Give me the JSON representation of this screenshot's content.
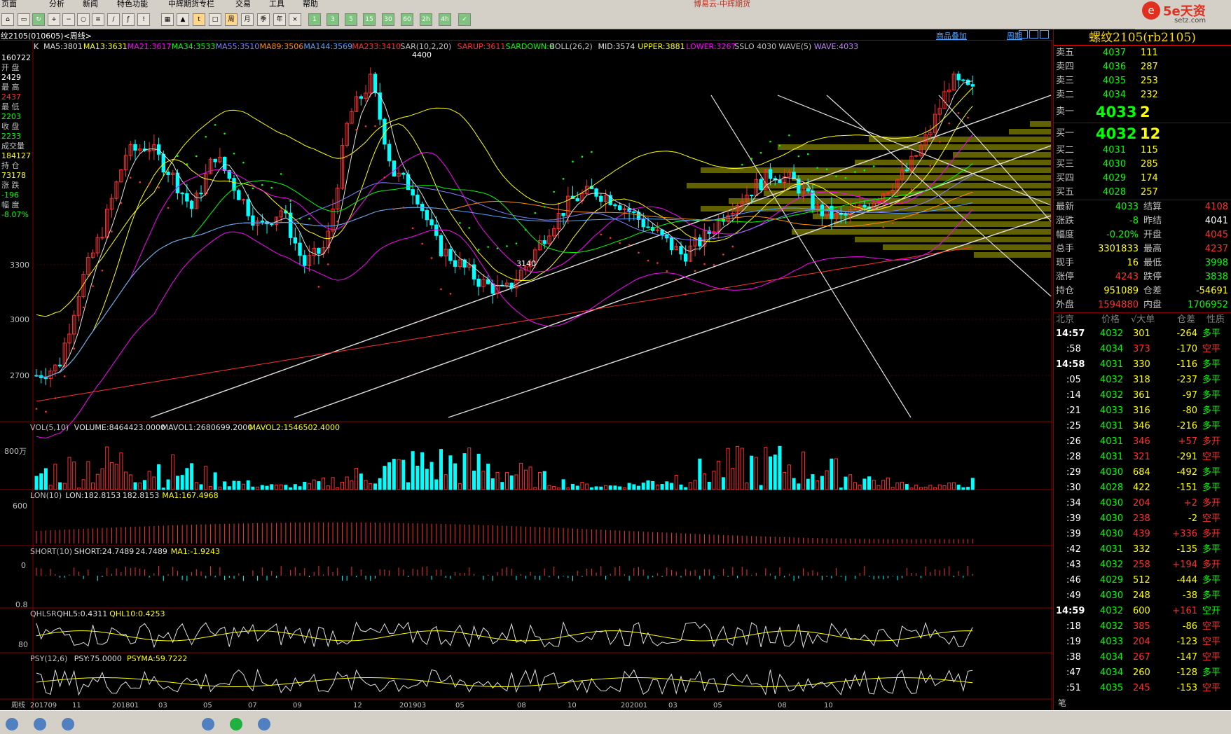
{
  "menu": [
    "页面",
    "分析",
    "新闻",
    "特色功能",
    "中辉期货专栏",
    "交易",
    "工具",
    "帮助"
  ],
  "window_title": "博易云-中辉期货",
  "logo_text": "5e天资",
  "logo_sub": "setz.com",
  "symbol_label": "纹2105(010605)<周线>",
  "header_links": [
    "商品叠加",
    "周期"
  ],
  "left_info": {
    "top_value": "160722",
    "rows": [
      {
        "label": "开 盘",
        "value": "2429",
        "color": "#ffffff"
      },
      {
        "label": "最 高",
        "value": "2437",
        "color": "#ff3030"
      },
      {
        "label": "最 低",
        "value": "2203",
        "color": "#00ff00"
      },
      {
        "label": "收 盘",
        "value": "2233",
        "color": "#00ff00"
      },
      {
        "label": "成交量",
        "value": "184127",
        "color": "#ffff00"
      },
      {
        "label": "持 仓",
        "value": "73178",
        "color": "#ffff00"
      },
      {
        "label": "涨 跌",
        "value": "-196",
        "color": "#00ff00"
      },
      {
        "label": "幅 度",
        "value": "-8.07%",
        "color": "#00ff00"
      }
    ]
  },
  "ma_legend": [
    {
      "text": "K",
      "color": "#e0e0e0"
    },
    {
      "text": "MA5:3801",
      "color": "#e0e0e0"
    },
    {
      "text": "MA13:3631",
      "color": "#ffff00"
    },
    {
      "text": "MA21:3617",
      "color": "#ff00ff"
    },
    {
      "text": "MA34:3533",
      "color": "#00ff00"
    },
    {
      "text": "MA55:3510",
      "color": "#8080ff"
    },
    {
      "text": "MA89:3506",
      "color": "#ff8c00"
    },
    {
      "text": "MA144:3569",
      "color": "#4fa3ff"
    },
    {
      "text": "MA233:3410",
      "color": "#ff3030"
    },
    {
      "text": "SAR(10,2,20)",
      "color": "#c0c0c0"
    },
    {
      "text": "SARUP:3611",
      "color": "#ff3030"
    },
    {
      "text": "SARDOWN:0",
      "color": "#00ff00"
    },
    {
      "text": "BOLL(26,2)",
      "color": "#c0c0c0"
    },
    {
      "text": "MID:3574",
      "color": "#e0e0e0"
    },
    {
      "text": "UPPER:3881",
      "color": "#ffff00"
    },
    {
      "text": "LOWER:3267",
      "color": "#ff00ff"
    },
    {
      "text": "SSLO 4030",
      "color": "#c0c0c0"
    },
    {
      "text": "WAVE(5)",
      "color": "#c0c0c0"
    },
    {
      "text": "WAVE:4033",
      "color": "#c080ff"
    }
  ],
  "price_axis": [
    "3300",
    "3000",
    "2700"
  ],
  "annotations": {
    "high": "4400",
    "low": "3140"
  },
  "vol_legend": [
    {
      "text": "VOL(5,10)",
      "color": "#c0c0c0"
    },
    {
      "text": "VOLUME:8464423.0000",
      "color": "#e0e0e0"
    },
    {
      "text": "MAVOL1:2680699.2000",
      "color": "#e0e0e0"
    },
    {
      "text": "MAVOL2:1546502.4000",
      "color": "#ffff00"
    }
  ],
  "vol_axis": "800万",
  "lon_legend": [
    {
      "text": "LON(10)",
      "color": "#c0c0c0"
    },
    {
      "text": "LON:182.8153",
      "color": "#e0e0e0"
    },
    {
      "text": "182.8153",
      "color": "#e0e0e0"
    },
    {
      "text": "MA1:167.4968",
      "color": "#ffff00"
    }
  ],
  "lon_axis": "600",
  "short_legend": [
    {
      "text": "SHORT(10)",
      "color": "#c0c0c0"
    },
    {
      "text": "SHORT:24.7489",
      "color": "#e0e0e0"
    },
    {
      "text": "24.7489",
      "color": "#e0e0e0"
    },
    {
      "text": "MA1:-1.9243",
      "color": "#ffff00"
    }
  ],
  "short_axis": "0",
  "qhl_legend": [
    {
      "text": "QHLSR",
      "color": "#c0c0c0"
    },
    {
      "text": "QHL5:0.4311",
      "color": "#e0e0e0"
    },
    {
      "text": "QHL10:0.4253",
      "color": "#ffff00"
    }
  ],
  "qhl_axis": "0.8",
  "psy_legend": [
    {
      "text": "PSY(12,6)",
      "color": "#c0c0c0"
    },
    {
      "text": "PSY:75.0000",
      "color": "#e0e0e0"
    },
    {
      "text": "PSYMA:59.7222",
      "color": "#ffff00"
    }
  ],
  "psy_axis": "80",
  "x_axis": [
    "周线",
    "201709",
    "11",
    "201801",
    "03",
    "05",
    "07",
    "09",
    "12",
    "201903",
    "05",
    "08",
    "10",
    "202001",
    "03",
    "05",
    "08",
    "10"
  ],
  "sidebar": {
    "title": "螺纹2105(rb2105)",
    "asks": [
      {
        "label": "卖五",
        "price": "4037",
        "vol": "111"
      },
      {
        "label": "卖四",
        "price": "4036",
        "vol": "287"
      },
      {
        "label": "卖三",
        "price": "4035",
        "vol": "253"
      },
      {
        "label": "卖二",
        "price": "4034",
        "vol": "232"
      }
    ],
    "ask1": {
      "label": "卖一",
      "price": "4033",
      "vol": "2"
    },
    "bid1": {
      "label": "买一",
      "price": "4032",
      "vol": "12"
    },
    "bids": [
      {
        "label": "买二",
        "price": "4031",
        "vol": "115"
      },
      {
        "label": "买三",
        "price": "4030",
        "vol": "285"
      },
      {
        "label": "买四",
        "price": "4029",
        "vol": "174"
      },
      {
        "label": "买五",
        "price": "4028",
        "vol": "257"
      }
    ],
    "stats": [
      {
        "l1": "最新",
        "v1": "4033",
        "c1": "#00ff00",
        "l2": "结算",
        "v2": "4108",
        "c2": "#ff3030"
      },
      {
        "l1": "涨跌",
        "v1": "-8",
        "c1": "#00ff00",
        "l2": "昨结",
        "v2": "4041",
        "c2": "#ffffff"
      },
      {
        "l1": "幅度",
        "v1": "-0.20%",
        "c1": "#00ff00",
        "l2": "开盘",
        "v2": "4045",
        "c2": "#ff3030"
      },
      {
        "l1": "总手",
        "v1": "3301833",
        "c1": "#ffff00",
        "l2": "最高",
        "v2": "4237",
        "c2": "#ff3030"
      },
      {
        "l1": "现手",
        "v1": "16",
        "c1": "#ffff00",
        "l2": "最低",
        "v2": "3998",
        "c2": "#00ff00"
      },
      {
        "l1": "涨停",
        "v1": "4243",
        "c1": "#ff3030",
        "l2": "跌停",
        "v2": "3838",
        "c2": "#00ff00"
      },
      {
        "l1": "持仓",
        "v1": "951089",
        "c1": "#ffff00",
        "l2": "仓差",
        "v2": "-54691",
        "c2": "#ffff00"
      },
      {
        "l1": "外盘",
        "v1": "1594880",
        "c1": "#ff3030",
        "l2": "内盘",
        "v2": "1706952",
        "c2": "#00ff00"
      }
    ],
    "tick_headers": [
      "北京",
      "价格",
      "√大单",
      "仓差",
      "性质"
    ],
    "ticks": [
      {
        "t": "14:57",
        "p": "4032",
        "v": "301",
        "d": "-264",
        "n": "多平",
        "nc": "#00ff00",
        "vc": "#ffff00",
        "dc": "#ffff00"
      },
      {
        "t": ":58",
        "p": "4034",
        "v": "373",
        "d": "-170",
        "n": "空平",
        "nc": "#ff3030",
        "vc": "#ff3030",
        "dc": "#ffff00"
      },
      {
        "t": "14:58",
        "p": "4031",
        "v": "330",
        "d": "-116",
        "n": "多平",
        "nc": "#00ff00",
        "vc": "#ffff00",
        "dc": "#ffff00"
      },
      {
        "t": ":05",
        "p": "4032",
        "v": "318",
        "d": "-237",
        "n": "多平",
        "nc": "#00ff00",
        "vc": "#ffff00",
        "dc": "#ffff00"
      },
      {
        "t": ":14",
        "p": "4032",
        "v": "361",
        "d": "-97",
        "n": "多平",
        "nc": "#00ff00",
        "vc": "#ffff00",
        "dc": "#ffff00"
      },
      {
        "t": ":21",
        "p": "4033",
        "v": "316",
        "d": "-80",
        "n": "多平",
        "nc": "#00ff00",
        "vc": "#ffff00",
        "dc": "#ffff00"
      },
      {
        "t": ":25",
        "p": "4031",
        "v": "346",
        "d": "-216",
        "n": "多平",
        "nc": "#00ff00",
        "vc": "#ffff00",
        "dc": "#ffff00"
      },
      {
        "t": ":26",
        "p": "4031",
        "v": "346",
        "d": "+57",
        "n": "多开",
        "nc": "#ff3030",
        "vc": "#ff3030",
        "dc": "#ff3030"
      },
      {
        "t": ":28",
        "p": "4031",
        "v": "321",
        "d": "-291",
        "n": "空平",
        "nc": "#ff3030",
        "vc": "#ff3030",
        "dc": "#ffff00"
      },
      {
        "t": ":29",
        "p": "4030",
        "v": "684",
        "d": "-492",
        "n": "多平",
        "nc": "#00ff00",
        "vc": "#ffff00",
        "dc": "#ffff00"
      },
      {
        "t": ":30",
        "p": "4028",
        "v": "422",
        "d": "-151",
        "n": "多平",
        "nc": "#00ff00",
        "vc": "#ffff00",
        "dc": "#ffff00"
      },
      {
        "t": ":34",
        "p": "4030",
        "v": "204",
        "d": "+2",
        "n": "多开",
        "nc": "#ff3030",
        "vc": "#ff3030",
        "dc": "#ff3030"
      },
      {
        "t": ":39",
        "p": "4030",
        "v": "238",
        "d": "-2",
        "n": "空平",
        "nc": "#ff3030",
        "vc": "#ff3030",
        "dc": "#ffff00"
      },
      {
        "t": ":39",
        "p": "4030",
        "v": "439",
        "d": "+336",
        "n": "多开",
        "nc": "#ff3030",
        "vc": "#ff3030",
        "dc": "#ff3030"
      },
      {
        "t": ":42",
        "p": "4031",
        "v": "332",
        "d": "-135",
        "n": "多平",
        "nc": "#00ff00",
        "vc": "#ffff00",
        "dc": "#ffff00"
      },
      {
        "t": ":43",
        "p": "4032",
        "v": "258",
        "d": "+194",
        "n": "多开",
        "nc": "#ff3030",
        "vc": "#ff3030",
        "dc": "#ff3030"
      },
      {
        "t": ":46",
        "p": "4029",
        "v": "512",
        "d": "-444",
        "n": "多平",
        "nc": "#00ff00",
        "vc": "#ffff00",
        "dc": "#ffff00"
      },
      {
        "t": ":49",
        "p": "4030",
        "v": "248",
        "d": "-38",
        "n": "多平",
        "nc": "#00ff00",
        "vc": "#ffff00",
        "dc": "#ffff00"
      },
      {
        "t": "14:59",
        "p": "4032",
        "v": "600",
        "d": "+161",
        "n": "空开",
        "nc": "#00ff00",
        "vc": "#ffff00",
        "dc": "#ff3030"
      },
      {
        "t": ":18",
        "p": "4032",
        "v": "385",
        "d": "-86",
        "n": "空平",
        "nc": "#ff3030",
        "vc": "#ff3030",
        "dc": "#ffff00"
      },
      {
        "t": ":19",
        "p": "4033",
        "v": "204",
        "d": "-123",
        "n": "空平",
        "nc": "#ff3030",
        "vc": "#ff3030",
        "dc": "#ffff00"
      },
      {
        "t": ":38",
        "p": "4034",
        "v": "267",
        "d": "-147",
        "n": "空平",
        "nc": "#ff3030",
        "vc": "#ff3030",
        "dc": "#ffff00"
      },
      {
        "t": ":47",
        "p": "4034",
        "v": "260",
        "d": "-128",
        "n": "多平",
        "nc": "#00ff00",
        "vc": "#ffff00",
        "dc": "#ffff00"
      },
      {
        "t": ":51",
        "p": "4035",
        "v": "245",
        "d": "-153",
        "n": "空平",
        "nc": "#ff3030",
        "vc": "#ff3030",
        "dc": "#ffff00"
      }
    ],
    "footer": "笔"
  },
  "colors": {
    "up": "#ff3030",
    "down": "#00ffff",
    "bg": "#000000",
    "grid": "#8b0000"
  },
  "chart_data": {
    "type": "line",
    "subtype": "candlestick-weekly",
    "series": [
      {
        "name": "MA5",
        "last": 3801
      },
      {
        "name": "MA13",
        "last": 3631
      },
      {
        "name": "MA21",
        "last": 3617
      },
      {
        "name": "MA34",
        "last": 3533
      },
      {
        "name": "MA55",
        "last": 3510
      },
      {
        "name": "MA89",
        "last": 3506
      },
      {
        "name": "MA144",
        "last": 3569
      },
      {
        "name": "MA233",
        "last": 3410
      },
      {
        "name": "SARUP",
        "last": 3611
      },
      {
        "name": "UPPER",
        "last": 3881
      },
      {
        "name": "MID",
        "last": 3574
      },
      {
        "name": "LOWER",
        "last": 3267
      },
      {
        "name": "WAVE",
        "last": 4033
      }
    ],
    "annotations": [
      {
        "text": "4400"
      },
      {
        "text": "3140"
      }
    ],
    "y_ticks": [
      3300,
      3000,
      2700
    ]
  }
}
